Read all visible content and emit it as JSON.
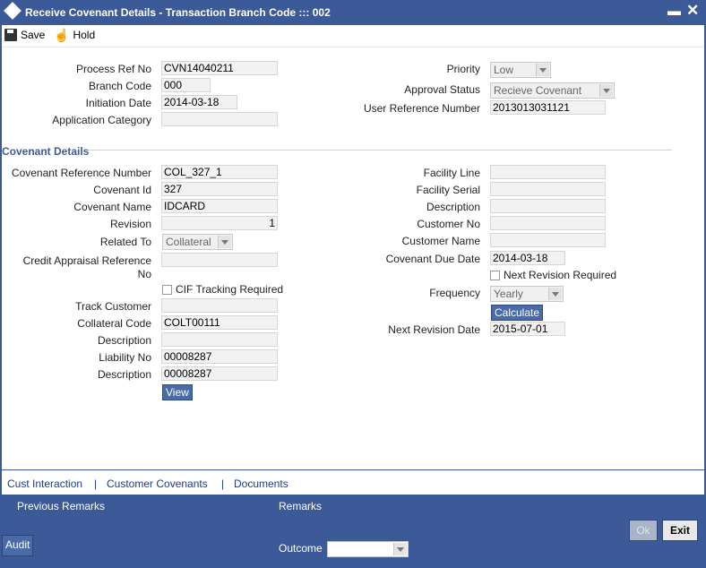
{
  "window": {
    "title": "Receive Covenant Details - Transaction Branch Code ::: 002"
  },
  "toolbar": {
    "save_label": "Save",
    "hold_label": "Hold"
  },
  "header": {
    "process_ref_no_label": "Process Ref No",
    "process_ref_no": "CVN14040211",
    "branch_code_label": "Branch Code",
    "branch_code": "000",
    "initiation_date_label": "Initiation Date",
    "initiation_date": "2014-03-18",
    "application_category_label": "Application Category",
    "application_category": "",
    "priority_label": "Priority",
    "priority": "Low",
    "approval_status_label": "Approval Status",
    "approval_status": "Recieve Covenant",
    "user_reference_number_label": "User Reference Number",
    "user_reference_number": "2013013031121"
  },
  "covenant": {
    "section_title": "Covenant Details",
    "ref_no_label": "Covenant Reference Number",
    "ref_no": "COL_327_1",
    "id_label": "Covenant Id",
    "id": "327",
    "name_label": "Covenant Name",
    "name": "IDCARD",
    "revision_label": "Revision",
    "revision": "1",
    "related_to_label": "Related To",
    "related_to": "Collateral",
    "credit_appraisal_label": "Credit Appraisal Reference No",
    "credit_appraisal": "",
    "cif_tracking_label": "CIF Tracking Required",
    "track_customer_label": "Track Customer",
    "track_customer": "",
    "collateral_code_label": "Collateral Code",
    "collateral_code": "COLT00111",
    "description1_label": "Description",
    "description1": "",
    "liability_no_label": "Liability No",
    "liability_no": "00008287",
    "description2_label": "Description",
    "description2": "00008287",
    "view_label": "View",
    "facility_line_label": "Facility Line",
    "facility_line": "",
    "facility_serial_label": "Facility Serial",
    "facility_serial": "",
    "description_r_label": "Description",
    "description_r": "",
    "customer_no_label": "Customer No",
    "customer_no": "",
    "customer_name_label": "Customer Name",
    "customer_name": "",
    "due_date_label": "Covenant Due Date",
    "due_date": "2014-03-18",
    "next_revision_required_label": "Next Revision Required",
    "frequency_label": "Frequency",
    "frequency": "Yearly",
    "calculate_label": "Calculate",
    "next_revision_date_label": "Next Revision Date",
    "next_revision_date": "2015-07-01"
  },
  "links": {
    "cust_interaction": "Cust Interaction",
    "sep": "|",
    "customer_covenants": "Customer Covenants",
    "documents": "Documents"
  },
  "footer": {
    "previous_remarks_label": "Previous Remarks",
    "remarks_label": "Remarks",
    "audit_label": "Audit",
    "outcome_label": "Outcome",
    "ok_label": "Ok",
    "exit_label": "Exit"
  }
}
